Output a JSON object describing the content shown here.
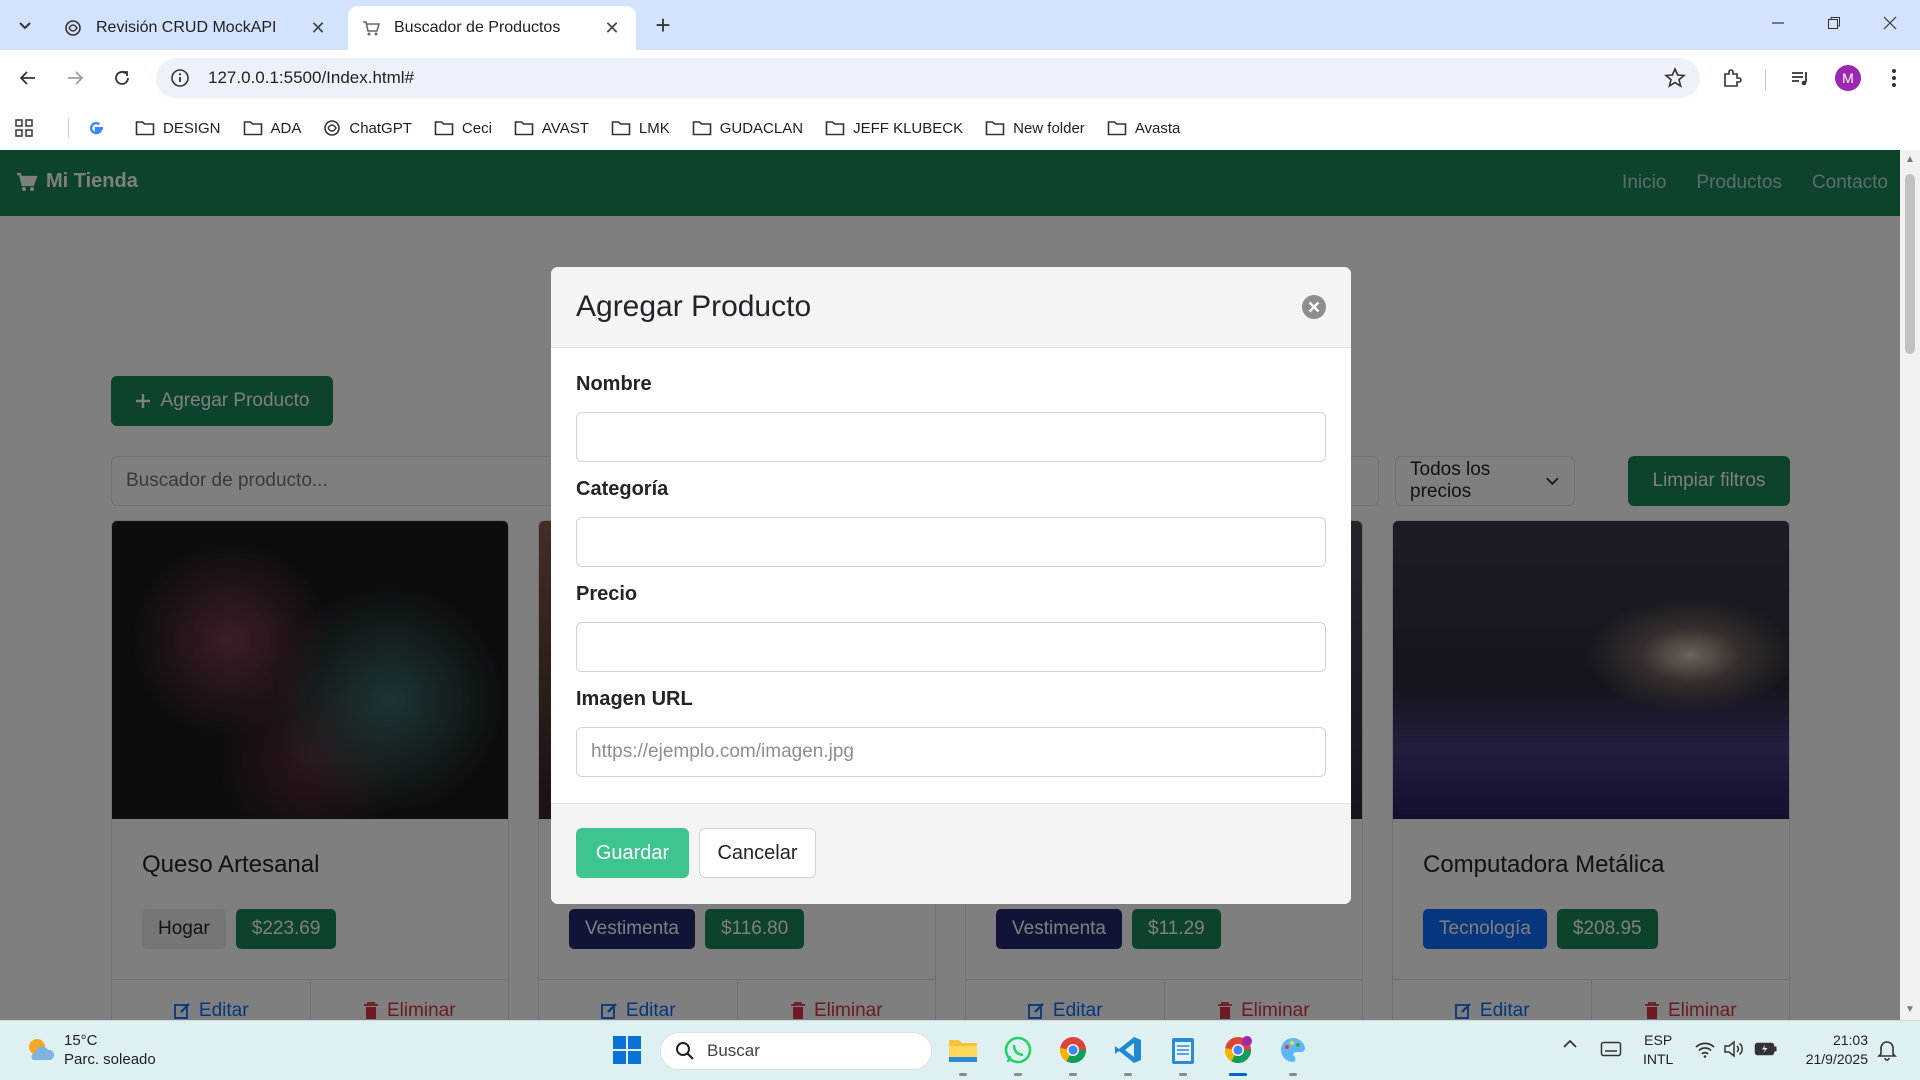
{
  "browser": {
    "tabs": [
      {
        "title": "Revisión CRUD MockAPI",
        "active": false
      },
      {
        "title": "Buscador de Productos",
        "active": true
      }
    ],
    "url": "127.0.0.1:5500/Index.html#",
    "avatar_letter": "M",
    "bookmarks": [
      "DESIGN",
      "ADA",
      "ChatGPT",
      "Ceci",
      "AVAST",
      "LMK",
      "GUDACLAN",
      "JEFF KLUBECK",
      "New folder",
      "Avasta"
    ]
  },
  "site": {
    "brand": "Mi Tienda",
    "nav_links": [
      "Inicio",
      "Productos",
      "Contacto"
    ],
    "add_button": "Agregar Producto",
    "search_placeholder": "Buscador de producto...",
    "price_filter": "Todos los precios",
    "clear_button": "Limpiar filtros",
    "products": [
      {
        "name": "Queso Artesanal",
        "category": "Hogar",
        "price": "$223.69",
        "edit": "Editar",
        "delete": "Eliminar"
      },
      {
        "name": "",
        "category": "Vestimenta",
        "price": "$116.80",
        "edit": "Editar",
        "delete": "Eliminar"
      },
      {
        "name": "",
        "category": "Vestimenta",
        "price": "$11.29",
        "edit": "Editar",
        "delete": "Eliminar"
      },
      {
        "name": "Computadora Metálica",
        "category": "Tecnología",
        "price": "$208.95",
        "edit": "Editar",
        "delete": "Eliminar"
      }
    ]
  },
  "modal": {
    "title": "Agregar Producto",
    "fields": [
      {
        "label": "Nombre",
        "value": "",
        "placeholder": ""
      },
      {
        "label": "Categoría",
        "value": "",
        "placeholder": ""
      },
      {
        "label": "Precio",
        "value": "",
        "placeholder": ""
      },
      {
        "label": "Imagen URL",
        "value": "",
        "placeholder": "https://ejemplo.com/imagen.jpg"
      }
    ],
    "save_label": "Guardar",
    "cancel_label": "Cancelar"
  },
  "taskbar": {
    "temperature": "15°C",
    "weather": "Parc. soleado",
    "search": "Buscar",
    "lang_1": "ESP",
    "lang_2": "INTL",
    "time": "21:03",
    "date": "21/9/2025"
  },
  "colors": {
    "brand_green": "#198754",
    "save_green": "#3ec48e",
    "chrome_blue": "#d3e3fd"
  }
}
